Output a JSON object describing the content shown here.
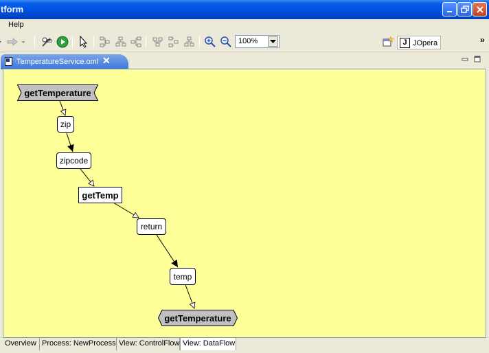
{
  "window": {
    "title": "tform"
  },
  "menu": {
    "help": "Help"
  },
  "toolbar": {
    "zoom": "100%",
    "perspective_logo": "J",
    "perspective_label": "JOpera",
    "overflow": "»"
  },
  "editor": {
    "tab_title": "TemperatureService.oml",
    "tab_close": "✕"
  },
  "graph": {
    "in_param": "getTemperature",
    "zip": "zip",
    "zipcode": "zipcode",
    "task": "getTemp",
    "return": "return",
    "temp": "temp",
    "out_param": "getTemperature"
  },
  "bottom_tabs": [
    "Overview",
    "Process: NewProcess",
    "View: ControlFlow",
    "View: DataFlow"
  ],
  "colors": {
    "canvas": "#ffff99",
    "titlebar": "#0054e3",
    "tab": "#3c76d8"
  }
}
